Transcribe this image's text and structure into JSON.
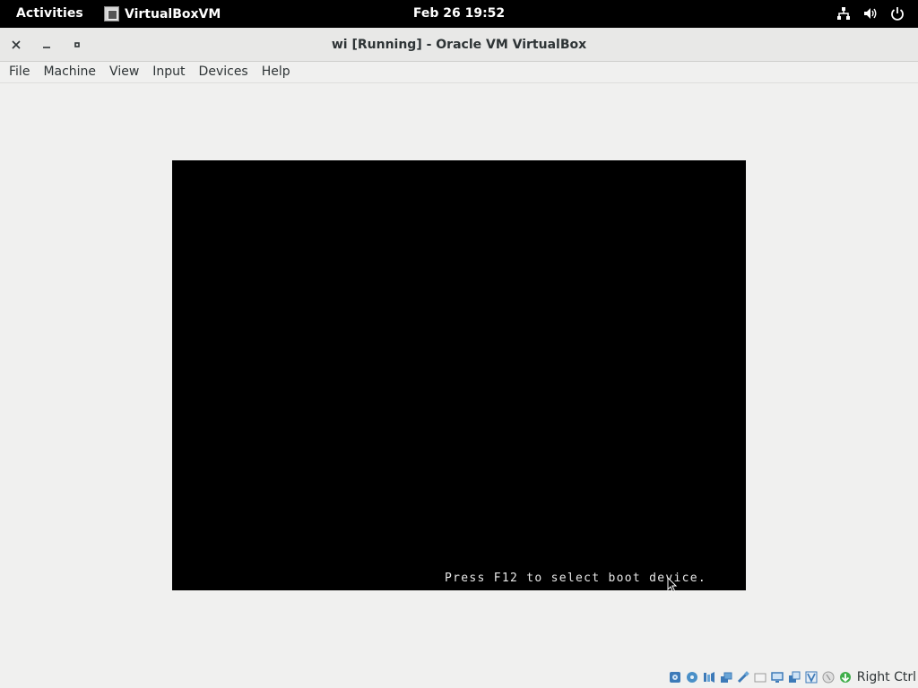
{
  "topbar": {
    "activities": "Activities",
    "app_name": "VirtualBoxVM",
    "clock": "Feb 26  19:52",
    "icons": [
      "network-icon",
      "volume-icon",
      "power-icon"
    ]
  },
  "window": {
    "title": "wi [Running] - Oracle VM VirtualBox"
  },
  "menubar": {
    "items": [
      "File",
      "Machine",
      "View",
      "Input",
      "Devices",
      "Help"
    ]
  },
  "vm": {
    "boot_message": "Press F12 to select boot device."
  },
  "statusbar": {
    "icons": [
      "hard-disk-icon",
      "optical-drive-icon",
      "audio-icon",
      "network-adapter-icon",
      "usb-icon",
      "shared-folders-icon",
      "display-icon",
      "video-capture-icon",
      "virtualization-icon",
      "mouse-integration-icon",
      "keyboard-capture-icon"
    ],
    "host_key": "Right Ctrl"
  },
  "colors": {
    "topbar_bg": "#000000",
    "window_bg": "#f0f0ef",
    "vm_bg": "#000000",
    "boot_text": "#e8e8e8"
  }
}
